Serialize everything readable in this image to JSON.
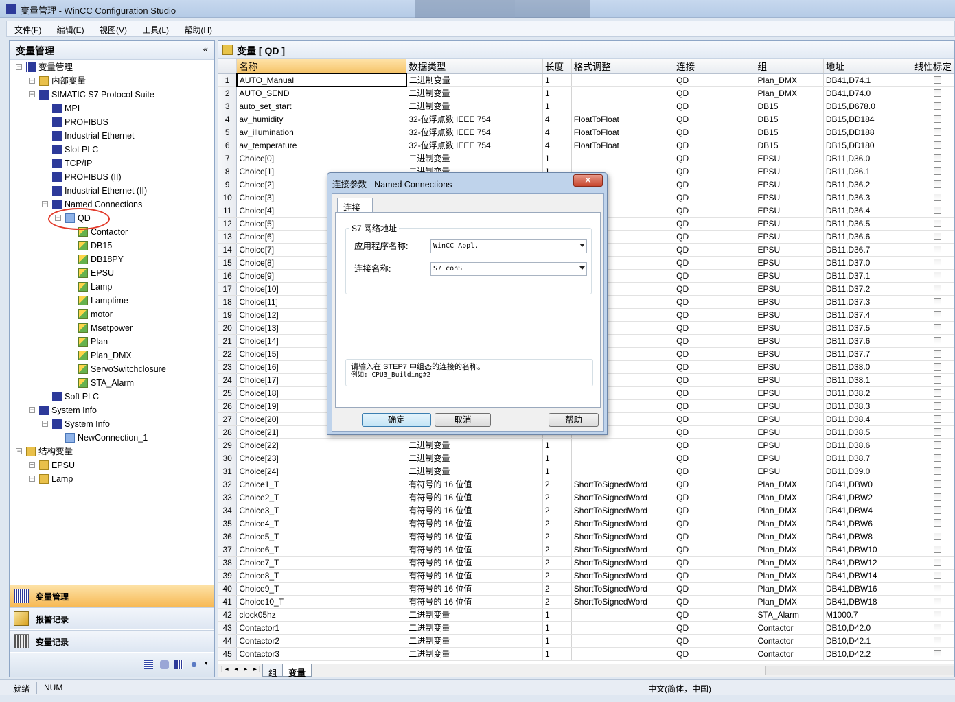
{
  "window": {
    "title": "变量管理 - WinCC Configuration Studio"
  },
  "menu": [
    "文件(F)",
    "编辑(E)",
    "视图(V)",
    "工具(L)",
    "帮助(H)"
  ],
  "left_panel": {
    "title": "变量管理",
    "collapse_glyph": "«",
    "tree": [
      {
        "label": "变量管理",
        "level": 0,
        "icon": "tag-management-icon",
        "toggle": "−"
      },
      {
        "label": "内部变量",
        "level": 1,
        "icon": "internal-tags-icon",
        "toggle": "+"
      },
      {
        "label": "SIMATIC S7 Protocol Suite",
        "level": 1,
        "icon": "driver-icon",
        "toggle": "−"
      },
      {
        "label": "MPI",
        "level": 2,
        "icon": "channel-icon"
      },
      {
        "label": "PROFIBUS",
        "level": 2,
        "icon": "channel-icon"
      },
      {
        "label": "Industrial Ethernet",
        "level": 2,
        "icon": "channel-icon"
      },
      {
        "label": "Slot PLC",
        "level": 2,
        "icon": "channel-icon"
      },
      {
        "label": "TCP/IP",
        "level": 2,
        "icon": "channel-icon"
      },
      {
        "label": "PROFIBUS (II)",
        "level": 2,
        "icon": "channel-icon"
      },
      {
        "label": "Industrial Ethernet (II)",
        "level": 2,
        "icon": "channel-icon"
      },
      {
        "label": "Named Connections",
        "level": 2,
        "icon": "channel-icon",
        "toggle": "−"
      },
      {
        "label": "QD",
        "level": 3,
        "icon": "connection-warning-icon",
        "toggle": "−"
      },
      {
        "label": "Contactor",
        "level": 4,
        "icon": "tag-group-icon"
      },
      {
        "label": "DB15",
        "level": 4,
        "icon": "tag-group-icon"
      },
      {
        "label": "DB18PY",
        "level": 4,
        "icon": "tag-group-icon"
      },
      {
        "label": "EPSU",
        "level": 4,
        "icon": "tag-group-icon"
      },
      {
        "label": "Lamp",
        "level": 4,
        "icon": "tag-group-icon"
      },
      {
        "label": "Lamptime",
        "level": 4,
        "icon": "tag-group-icon"
      },
      {
        "label": "motor",
        "level": 4,
        "icon": "tag-group-icon"
      },
      {
        "label": "Msetpower",
        "level": 4,
        "icon": "tag-group-icon"
      },
      {
        "label": "Plan",
        "level": 4,
        "icon": "tag-group-icon"
      },
      {
        "label": "Plan_DMX",
        "level": 4,
        "icon": "tag-group-icon"
      },
      {
        "label": "ServoSwitchclosure",
        "level": 4,
        "icon": "tag-group-icon"
      },
      {
        "label": "STA_Alarm",
        "level": 4,
        "icon": "tag-group-icon"
      },
      {
        "label": "Soft PLC",
        "level": 2,
        "icon": "channel-icon"
      },
      {
        "label": "System Info",
        "level": 1,
        "icon": "driver-icon",
        "toggle": "−"
      },
      {
        "label": "System Info",
        "level": 2,
        "icon": "channel-icon",
        "toggle": "−"
      },
      {
        "label": "NewConnection_1",
        "level": 3,
        "icon": "connection-icon"
      },
      {
        "label": "结构变量",
        "level": 0,
        "icon": "structure-tags-icon",
        "toggle": "−"
      },
      {
        "label": "EPSU",
        "level": 1,
        "icon": "structure-type-icon",
        "toggle": "+"
      },
      {
        "label": "Lamp",
        "level": 1,
        "icon": "structure-type-icon",
        "toggle": "+"
      }
    ],
    "nav_buttons": [
      {
        "label": "变量管理",
        "icon": "tag-management-icon",
        "active": true
      },
      {
        "label": "报警记录",
        "icon": "alarm-logging-icon",
        "active": false
      },
      {
        "label": "变量记录",
        "icon": "tag-logging-icon",
        "active": false
      }
    ]
  },
  "right_panel": {
    "title": "变量 [ QD ]",
    "columns": [
      "名称",
      "数据类型",
      "长度",
      "格式调整",
      "连接",
      "组",
      "地址",
      "线性标定"
    ],
    "rows": [
      [
        "1",
        "AUTO_Manual",
        "二进制变量",
        "1",
        "",
        "QD",
        "Plan_DMX",
        "DB41,D74.1"
      ],
      [
        "2",
        "AUTO_SEND",
        "二进制变量",
        "1",
        "",
        "QD",
        "Plan_DMX",
        "DB41,D74.0"
      ],
      [
        "3",
        "auto_set_start",
        "二进制变量",
        "1",
        "",
        "QD",
        "DB15",
        "DB15,D678.0"
      ],
      [
        "4",
        "av_humidity",
        "32-位浮点数 IEEE 754",
        "4",
        "FloatToFloat",
        "QD",
        "DB15",
        "DB15,DD184"
      ],
      [
        "5",
        "av_illumination",
        "32-位浮点数 IEEE 754",
        "4",
        "FloatToFloat",
        "QD",
        "DB15",
        "DB15,DD188"
      ],
      [
        "6",
        "av_temperature",
        "32-位浮点数 IEEE 754",
        "4",
        "FloatToFloat",
        "QD",
        "DB15",
        "DB15,DD180"
      ],
      [
        "7",
        "Choice[0]",
        "二进制变量",
        "1",
        "",
        "QD",
        "EPSU",
        "DB11,D36.0"
      ],
      [
        "8",
        "Choice[1]",
        "二进制变量",
        "1",
        "",
        "QD",
        "EPSU",
        "DB11,D36.1"
      ],
      [
        "9",
        "Choice[2]",
        "",
        "",
        "",
        "QD",
        "EPSU",
        "DB11,D36.2"
      ],
      [
        "10",
        "Choice[3]",
        "",
        "",
        "",
        "QD",
        "EPSU",
        "DB11,D36.3"
      ],
      [
        "11",
        "Choice[4]",
        "",
        "",
        "",
        "QD",
        "EPSU",
        "DB11,D36.4"
      ],
      [
        "12",
        "Choice[5]",
        "",
        "",
        "",
        "QD",
        "EPSU",
        "DB11,D36.5"
      ],
      [
        "13",
        "Choice[6]",
        "",
        "",
        "",
        "QD",
        "EPSU",
        "DB11,D36.6"
      ],
      [
        "14",
        "Choice[7]",
        "",
        "",
        "",
        "QD",
        "EPSU",
        "DB11,D36.7"
      ],
      [
        "15",
        "Choice[8]",
        "",
        "",
        "",
        "QD",
        "EPSU",
        "DB11,D37.0"
      ],
      [
        "16",
        "Choice[9]",
        "",
        "",
        "",
        "QD",
        "EPSU",
        "DB11,D37.1"
      ],
      [
        "17",
        "Choice[10]",
        "",
        "",
        "",
        "QD",
        "EPSU",
        "DB11,D37.2"
      ],
      [
        "18",
        "Choice[11]",
        "",
        "",
        "",
        "QD",
        "EPSU",
        "DB11,D37.3"
      ],
      [
        "19",
        "Choice[12]",
        "",
        "",
        "",
        "QD",
        "EPSU",
        "DB11,D37.4"
      ],
      [
        "20",
        "Choice[13]",
        "",
        "",
        "",
        "QD",
        "EPSU",
        "DB11,D37.5"
      ],
      [
        "21",
        "Choice[14]",
        "",
        "",
        "",
        "QD",
        "EPSU",
        "DB11,D37.6"
      ],
      [
        "22",
        "Choice[15]",
        "",
        "",
        "",
        "QD",
        "EPSU",
        "DB11,D37.7"
      ],
      [
        "23",
        "Choice[16]",
        "",
        "",
        "",
        "QD",
        "EPSU",
        "DB11,D38.0"
      ],
      [
        "24",
        "Choice[17]",
        "",
        "",
        "",
        "QD",
        "EPSU",
        "DB11,D38.1"
      ],
      [
        "25",
        "Choice[18]",
        "",
        "",
        "",
        "QD",
        "EPSU",
        "DB11,D38.2"
      ],
      [
        "26",
        "Choice[19]",
        "",
        "",
        "",
        "QD",
        "EPSU",
        "DB11,D38.3"
      ],
      [
        "27",
        "Choice[20]",
        "",
        "",
        "",
        "QD",
        "EPSU",
        "DB11,D38.4"
      ],
      [
        "28",
        "Choice[21]",
        "",
        "",
        "",
        "QD",
        "EPSU",
        "DB11,D38.5"
      ],
      [
        "29",
        "Choice[22]",
        "二进制变量",
        "1",
        "",
        "QD",
        "EPSU",
        "DB11,D38.6"
      ],
      [
        "30",
        "Choice[23]",
        "二进制变量",
        "1",
        "",
        "QD",
        "EPSU",
        "DB11,D38.7"
      ],
      [
        "31",
        "Choice[24]",
        "二进制变量",
        "1",
        "",
        "QD",
        "EPSU",
        "DB11,D39.0"
      ],
      [
        "32",
        "Choice1_T",
        "有符号的 16 位值",
        "2",
        "ShortToSignedWord",
        "QD",
        "Plan_DMX",
        "DB41,DBW0"
      ],
      [
        "33",
        "Choice2_T",
        "有符号的 16 位值",
        "2",
        "ShortToSignedWord",
        "QD",
        "Plan_DMX",
        "DB41,DBW2"
      ],
      [
        "34",
        "Choice3_T",
        "有符号的 16 位值",
        "2",
        "ShortToSignedWord",
        "QD",
        "Plan_DMX",
        "DB41,DBW4"
      ],
      [
        "35",
        "Choice4_T",
        "有符号的 16 位值",
        "2",
        "ShortToSignedWord",
        "QD",
        "Plan_DMX",
        "DB41,DBW6"
      ],
      [
        "36",
        "Choice5_T",
        "有符号的 16 位值",
        "2",
        "ShortToSignedWord",
        "QD",
        "Plan_DMX",
        "DB41,DBW8"
      ],
      [
        "37",
        "Choice6_T",
        "有符号的 16 位值",
        "2",
        "ShortToSignedWord",
        "QD",
        "Plan_DMX",
        "DB41,DBW10"
      ],
      [
        "38",
        "Choice7_T",
        "有符号的 16 位值",
        "2",
        "ShortToSignedWord",
        "QD",
        "Plan_DMX",
        "DB41,DBW12"
      ],
      [
        "39",
        "Choice8_T",
        "有符号的 16 位值",
        "2",
        "ShortToSignedWord",
        "QD",
        "Plan_DMX",
        "DB41,DBW14"
      ],
      [
        "40",
        "Choice9_T",
        "有符号的 16 位值",
        "2",
        "ShortToSignedWord",
        "QD",
        "Plan_DMX",
        "DB41,DBW16"
      ],
      [
        "41",
        "Choice10_T",
        "有符号的 16 位值",
        "2",
        "ShortToSignedWord",
        "QD",
        "Plan_DMX",
        "DB41,DBW18"
      ],
      [
        "42",
        "clock05hz",
        "二进制变量",
        "1",
        "",
        "QD",
        "STA_Alarm",
        "M1000.7"
      ],
      [
        "43",
        "Contactor1",
        "二进制变量",
        "1",
        "",
        "QD",
        "Contactor",
        "DB10,D42.0"
      ],
      [
        "44",
        "Contactor2",
        "二进制变量",
        "1",
        "",
        "QD",
        "Contactor",
        "DB10,D42.1"
      ],
      [
        "45",
        "Contactor3",
        "二进制变量",
        "1",
        "",
        "QD",
        "Contactor",
        "DB10,D42.2"
      ]
    ],
    "sheet_tabs": [
      "组",
      "变量"
    ],
    "sheet_nav": "|◂ ◂ ▸ ▸|"
  },
  "dialog": {
    "title": "连接参数 - Named Connections",
    "close": "✕",
    "tab": "连接",
    "group_title": "S7 网络地址",
    "app_name_label": "应用程序名称:",
    "app_name_value": "WinCC Appl.",
    "conn_name_label": "连接名称:",
    "conn_name_value": "S7 conS",
    "hint_line1": "请输入在 STEP7 中组态的连接的名称。",
    "hint_line2": "例如:  CPU3_Building#2",
    "ok": "确定",
    "cancel": "取消",
    "help": "帮助"
  },
  "status_bar": {
    "ready": "就绪",
    "num": "NUM",
    "locale": "中文(简体，中国)"
  }
}
